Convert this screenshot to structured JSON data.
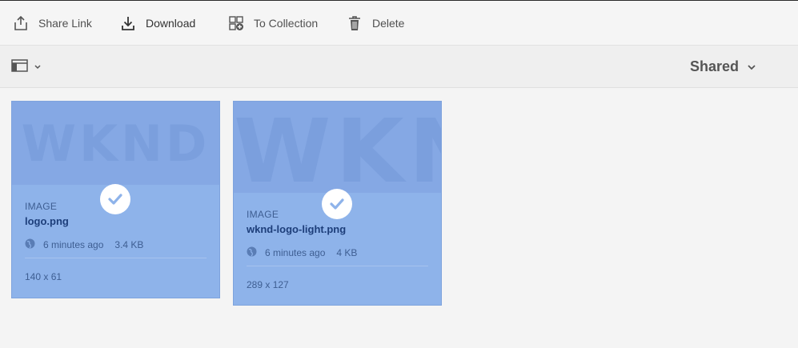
{
  "actionbar": {
    "share_link": "Share Link",
    "download": "Download",
    "to_collection": "To Collection",
    "delete": "Delete"
  },
  "toolbar": {
    "view_filter": "Shared"
  },
  "assets": [
    {
      "type_label": "IMAGE",
      "filename": "logo.png",
      "modified": "6 minutes ago",
      "size": "3.4 KB",
      "dimensions": "140 x 61",
      "thumb_text": "WKND",
      "selected": true
    },
    {
      "type_label": "IMAGE",
      "filename": "wknd-logo-light.png",
      "modified": "6 minutes ago",
      "size": "4 KB",
      "dimensions": "289 x 127",
      "thumb_text": "WKND",
      "selected": true
    }
  ],
  "colors": {
    "selection_overlay": "#8eb3ea",
    "filename": "#1d3e7a"
  }
}
